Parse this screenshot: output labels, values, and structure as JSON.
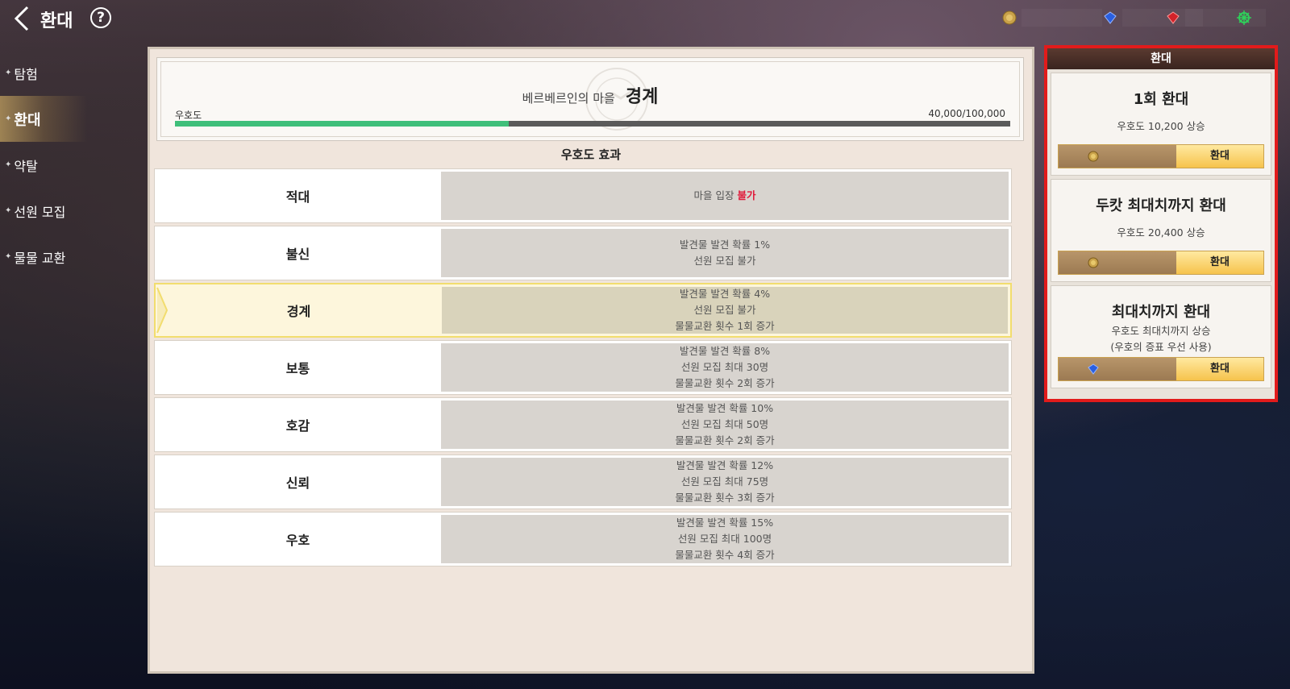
{
  "header": {
    "title": "환대",
    "help_icon_label": "?"
  },
  "currencies": [
    {
      "icon": "gold-coin-icon"
    },
    {
      "icon": "blue-gem-icon"
    },
    {
      "icon": "red-gem-icon"
    },
    {
      "icon": "ship-wheel-icon"
    }
  ],
  "sidebar": {
    "items": [
      {
        "label": "탐험",
        "active": false
      },
      {
        "label": "환대",
        "active": true
      },
      {
        "label": "약탈",
        "active": false
      },
      {
        "label": "선원 모집",
        "active": false
      },
      {
        "label": "물물 교환",
        "active": false
      }
    ]
  },
  "village": {
    "name": "베르베르인의 마을",
    "level": "경계",
    "favor_label": "우호도",
    "favor_text": "40,000/100,000",
    "favor_current": 40000,
    "favor_max": 100000
  },
  "effects": {
    "title": "우호도 효과",
    "rows": [
      {
        "name": "적대",
        "lines": [
          "마을 입장 "
        ],
        "highlight": "불가",
        "current": false
      },
      {
        "name": "불신",
        "lines": [
          "발견물 발견 확률 1%",
          "선원 모집 불가"
        ],
        "current": false
      },
      {
        "name": "경계",
        "lines": [
          "발견물 발견 확률 4%",
          "선원 모집 불가",
          "물물교환 횟수 1회 증가"
        ],
        "current": true
      },
      {
        "name": "보통",
        "lines": [
          "발견물 발견 확률 8%",
          "선원 모집 최대 30명",
          "물물교환 횟수 2회 증가"
        ],
        "current": false
      },
      {
        "name": "호감",
        "lines": [
          "발견물 발견 확률 10%",
          "선원 모집 최대 50명",
          "물물교환 횟수 2회 증가"
        ],
        "current": false
      },
      {
        "name": "신뢰",
        "lines": [
          "발견물 발견 확률 12%",
          "선원 모집 최대 75명",
          "물물교환 횟수 3회 증가"
        ],
        "current": false
      },
      {
        "name": "우호",
        "lines": [
          "발견물 발견 확률 15%",
          "선원 모집 최대 100명",
          "물물교환 횟수 4회 증가"
        ],
        "current": false
      }
    ]
  },
  "hospitality": {
    "title": "환대",
    "options": [
      {
        "title": "1회 환대",
        "desc": [
          "우호도 10,200 상승"
        ],
        "cost_icon": "gold-coin-icon",
        "button": "환대"
      },
      {
        "title": "두캇 최대치까지 환대",
        "desc": [
          "우호도 20,400 상승"
        ],
        "cost_icon": "gold-coin-icon",
        "button": "환대"
      },
      {
        "title": "최대치까지 환대",
        "desc": [
          "우호도 최대치까지 상승",
          "(우호의 증표 우선 사용)"
        ],
        "cost_icon": "blue-gem-icon",
        "button": "환대"
      }
    ]
  },
  "colors": {
    "favor_bar": "#3fbf7a",
    "highlight_text": "#e0193a",
    "current_row_border": "#f2dd6e",
    "side_border": "#e21b1b"
  }
}
